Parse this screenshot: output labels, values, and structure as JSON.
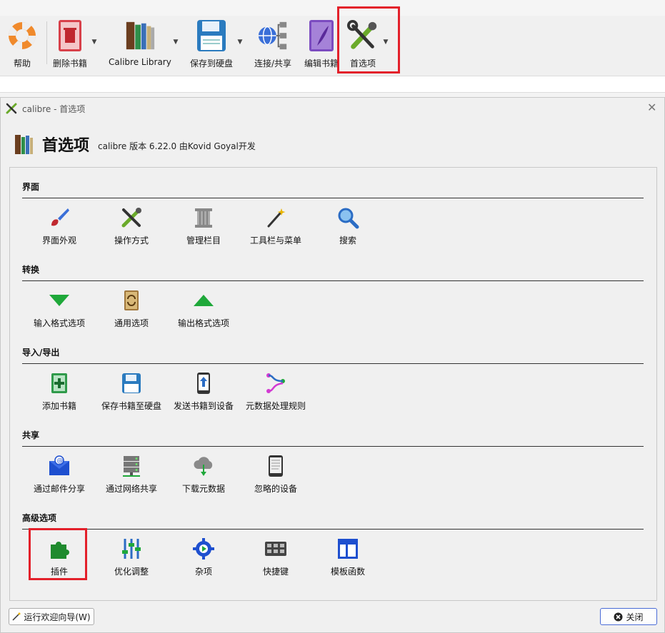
{
  "toolbar": {
    "items": [
      {
        "label": "帮助",
        "icon": "lifebuoy-icon"
      },
      {
        "label": "删除书籍",
        "icon": "trash-book-icon"
      },
      {
        "label": "Calibre Library",
        "icon": "library-books-icon"
      },
      {
        "label": "保存到硬盘",
        "icon": "floppy-save-icon"
      },
      {
        "label": "连接/共享",
        "icon": "network-globe-icon"
      },
      {
        "label": "编辑书籍",
        "icon": "purple-book-quill-icon"
      },
      {
        "label": "首选项",
        "icon": "tools-wrench-screwdriver-icon"
      }
    ]
  },
  "dialog": {
    "window_title": "calibre - 首选项",
    "heading": "首选项",
    "version_text": "calibre 版本 6.22.0 由Kovid Goyal开发",
    "sections": [
      {
        "title": "界面",
        "items": [
          "界面外观",
          "操作方式",
          "管理栏目",
          "工具栏与菜单",
          "搜索"
        ]
      },
      {
        "title": "转换",
        "items": [
          "输入格式选项",
          "通用选项",
          "输出格式选项"
        ]
      },
      {
        "title": "导入/导出",
        "items": [
          "添加书籍",
          "保存书籍至硬盘",
          "发送书籍到设备",
          "元数据处理规则"
        ]
      },
      {
        "title": "共享",
        "items": [
          "通过邮件分享",
          "通过网络共享",
          "下载元数据",
          "忽略的设备"
        ]
      },
      {
        "title": "高级选项",
        "items": [
          "插件",
          "优化调整",
          "杂项",
          "快捷键",
          "模板函数"
        ]
      }
    ],
    "wizard_button": "运行欢迎向导(W)",
    "close_button": "关闭"
  },
  "colors": {
    "highlight": "#e3202a",
    "accent_blue": "#1e4fcf"
  }
}
